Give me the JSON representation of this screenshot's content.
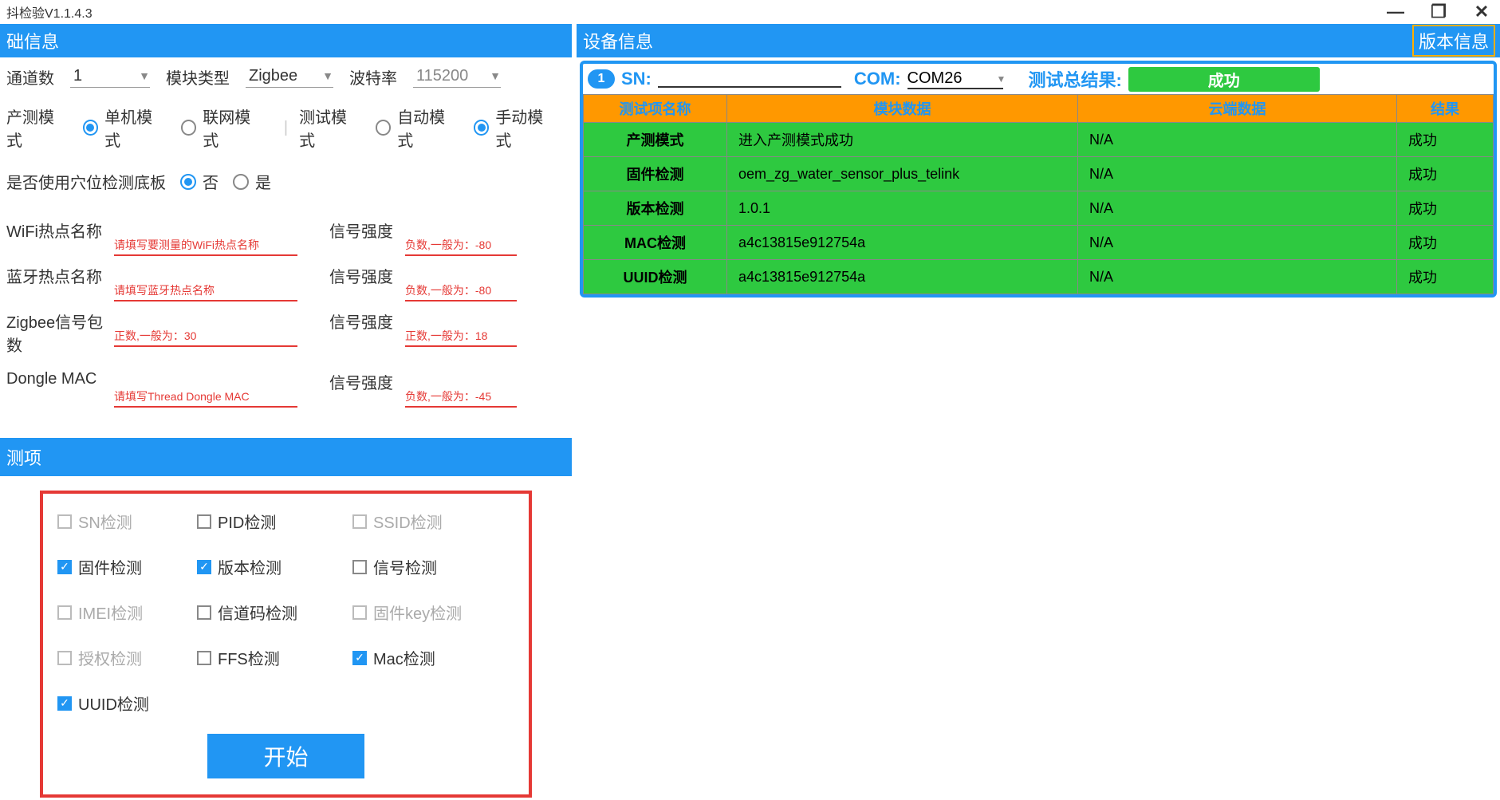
{
  "titlebar": {
    "title": "抖检验V1.1.4.3"
  },
  "headers": {
    "left": "础信息",
    "right": "设备信息",
    "versionBtn": "版本信息"
  },
  "configs": {
    "channels": {
      "label": "通道数",
      "value": "1"
    },
    "moduleType": {
      "label": "模块类型",
      "value": "Zigbee"
    },
    "baudRate": {
      "label": "波特率",
      "value": "115200"
    }
  },
  "modes": {
    "prodMode": "产测模式",
    "single": "单机模式",
    "network": "联网模式",
    "testMode": "测试模式",
    "auto": "自动模式",
    "manual": "手动模式"
  },
  "bottomBoard": {
    "label": "是否使用穴位检测底板",
    "no": "否",
    "yes": "是"
  },
  "fields": {
    "wifi": {
      "label": "WiFi热点名称",
      "hint": "请填写要测量的WiFi热点名称"
    },
    "wifiSignal": {
      "label": "信号强度",
      "hint": "负数,一般为：-80"
    },
    "bt": {
      "label": "蓝牙热点名称",
      "hint": "请填写蓝牙热点名称"
    },
    "btSignal": {
      "label": "信号强度",
      "hint": "负数,一般为：-80"
    },
    "zigbee": {
      "label": "Zigbee信号包数",
      "hint": "正数,一般为：30"
    },
    "zigbeeSignal": {
      "label": "信号强度",
      "hint": "正数,一般为：18"
    },
    "dongle": {
      "label": "Dongle MAC",
      "hint": "请填写Thread Dongle MAC"
    },
    "dongleSignal": {
      "label": "信号强度",
      "hint": "负数,一般为：-45"
    }
  },
  "detectSection": {
    "header": "测项",
    "startBtn": "开始"
  },
  "detectItems": {
    "sn": "SN检测",
    "pid": "PID检测",
    "ssid": "SSID检测",
    "firmware": "固件检测",
    "version": "版本检测",
    "signal": "信号检测",
    "imei": "IMEI检测",
    "channelCode": "信道码检测",
    "firmwareKey": "固件key检测",
    "auth": "授权检测",
    "ffs": "FFS检测",
    "mac": "Mac检测",
    "uuid": "UUID检测"
  },
  "device": {
    "number": "1",
    "snLabel": "SN:",
    "comLabel": "COM:",
    "comValue": "COM26",
    "resultLabel": "测试总结果:",
    "resultValue": "成功"
  },
  "tableHeaders": {
    "name": "测试项名称",
    "module": "模块数据",
    "cloud": "云端数据",
    "result": "结果"
  },
  "tableRows": [
    {
      "name": "产测模式",
      "module": "进入产测模式成功",
      "cloud": "N/A",
      "result": "成功"
    },
    {
      "name": "固件检测",
      "module": "oem_zg_water_sensor_plus_telink",
      "cloud": "N/A",
      "result": "成功"
    },
    {
      "name": "版本检测",
      "module": "1.0.1",
      "cloud": "N/A",
      "result": "成功"
    },
    {
      "name": "MAC检测",
      "module": "a4c13815e912754a",
      "cloud": "N/A",
      "result": "成功"
    },
    {
      "name": "UUID检测",
      "module": "a4c13815e912754a",
      "cloud": "N/A",
      "result": "成功"
    }
  ]
}
